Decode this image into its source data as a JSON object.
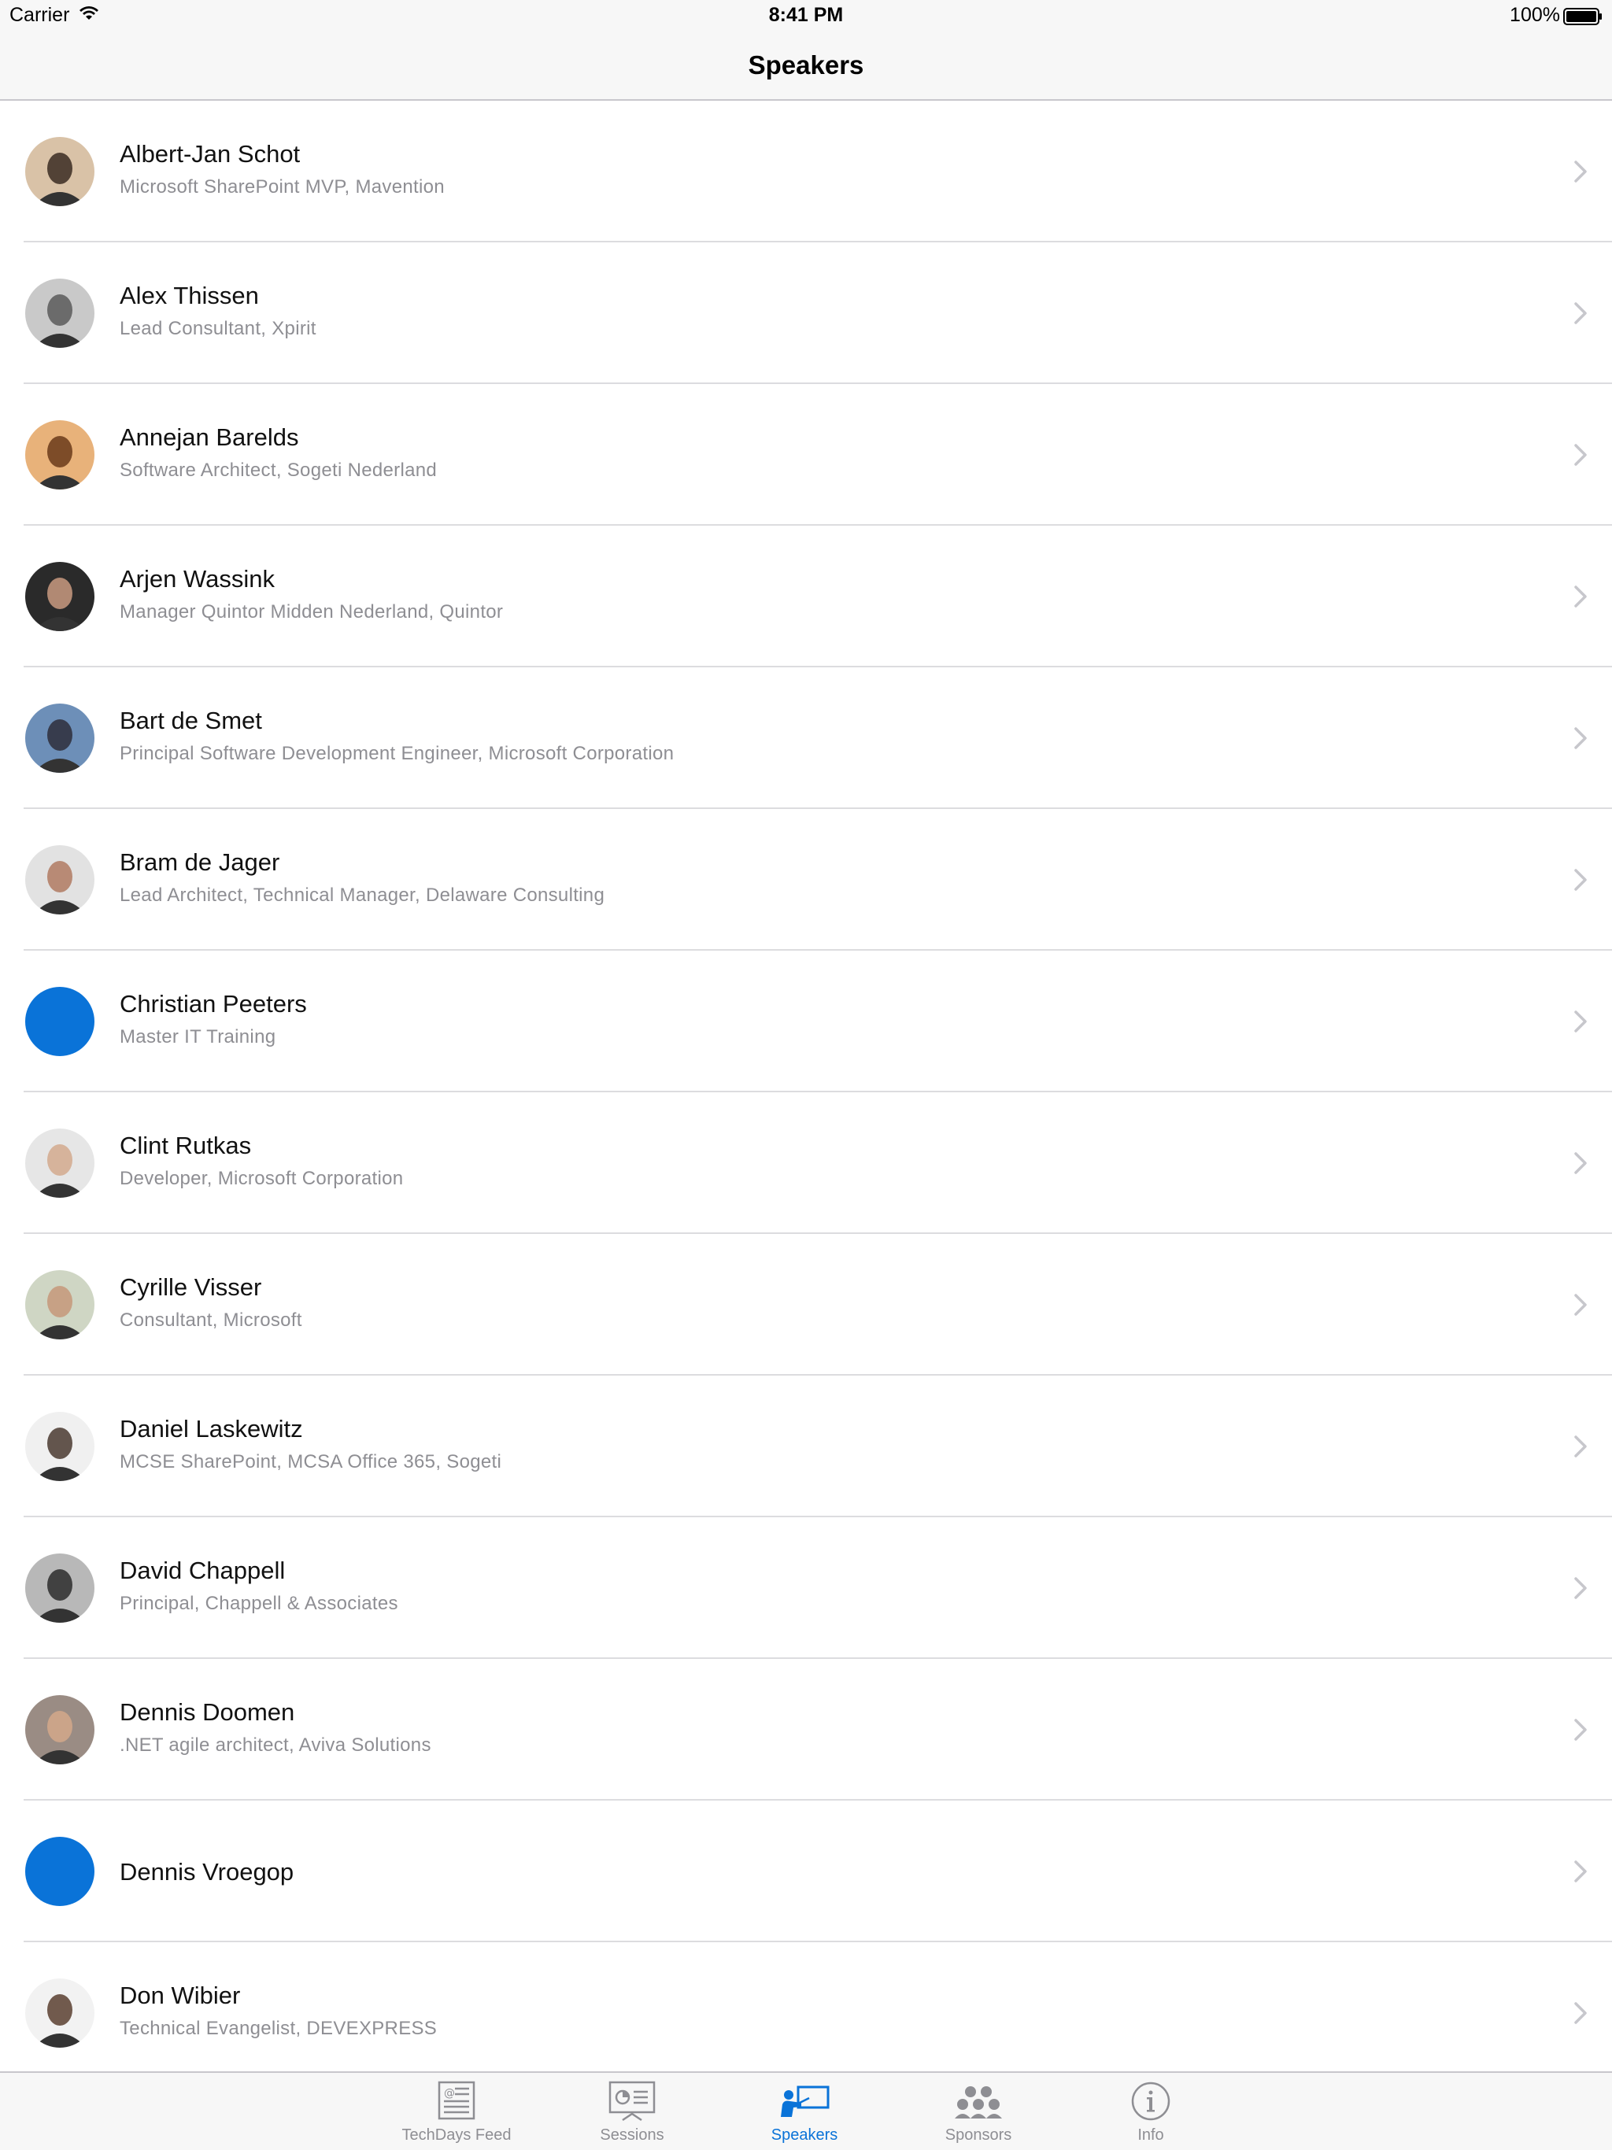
{
  "status_bar": {
    "carrier": "Carrier",
    "time": "8:41 PM",
    "battery": "100%"
  },
  "nav": {
    "title": "Speakers"
  },
  "speakers": [
    {
      "name": "Albert-Jan Schot",
      "subtitle": "Microsoft SharePoint MVP, Mavention",
      "avatar": "photo"
    },
    {
      "name": "Alex Thissen",
      "subtitle": "Lead Consultant, Xpirit",
      "avatar": "photo"
    },
    {
      "name": "Annejan Barelds",
      "subtitle": "Software Architect, Sogeti Nederland",
      "avatar": "photo"
    },
    {
      "name": "Arjen Wassink",
      "subtitle": "Manager Quintor Midden Nederland, Quintor",
      "avatar": "photo"
    },
    {
      "name": "Bart de Smet",
      "subtitle": "Principal Software Development Engineer, Microsoft Corporation",
      "avatar": "photo"
    },
    {
      "name": "Bram de Jager",
      "subtitle": "Lead Architect, Technical Manager, Delaware Consulting",
      "avatar": "photo"
    },
    {
      "name": "Christian Peeters",
      "subtitle": "Master IT Training",
      "avatar": "placeholder"
    },
    {
      "name": "Clint Rutkas",
      "subtitle": "Developer, Microsoft Corporation",
      "avatar": "photo"
    },
    {
      "name": "Cyrille Visser",
      "subtitle": "Consultant, Microsoft",
      "avatar": "photo"
    },
    {
      "name": "Daniel Laskewitz",
      "subtitle": "MCSE SharePoint, MCSA Office 365, Sogeti",
      "avatar": "photo"
    },
    {
      "name": "David Chappell",
      "subtitle": "Principal, Chappell & Associates",
      "avatar": "photo"
    },
    {
      "name": "Dennis Doomen",
      "subtitle": ".NET agile architect, Aviva Solutions",
      "avatar": "photo"
    },
    {
      "name": "Dennis Vroegop",
      "subtitle": "",
      "avatar": "placeholder"
    },
    {
      "name": "Don Wibier",
      "subtitle": "Technical Evangelist, DEVEXPRESS",
      "avatar": "photo"
    }
  ],
  "tabs": [
    {
      "label": "TechDays Feed",
      "icon": "newspaper-icon",
      "active": false
    },
    {
      "label": "Sessions",
      "icon": "presentation-icon",
      "active": false
    },
    {
      "label": "Speakers",
      "icon": "speaker-icon",
      "active": true
    },
    {
      "label": "Sponsors",
      "icon": "people-icon",
      "active": false
    },
    {
      "label": "Info",
      "icon": "info-icon",
      "active": false
    }
  ],
  "colors": {
    "accent": "#0a73d8",
    "secondary_text": "#8e8e93",
    "bar_background": "#f7f7f7",
    "separator": "#dcdcdf"
  }
}
